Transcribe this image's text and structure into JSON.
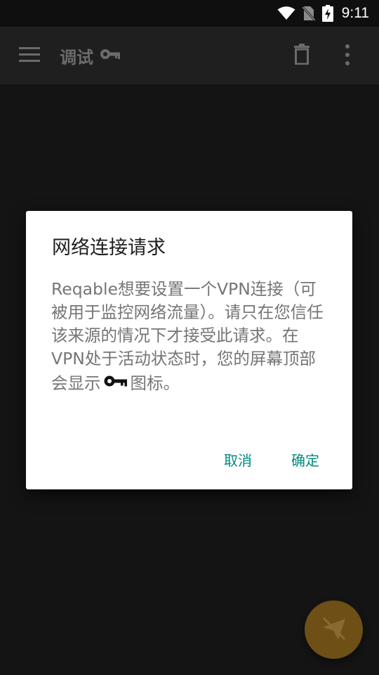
{
  "status_bar": {
    "time": "9:11",
    "icons": [
      "wifi-icon",
      "no-sim-icon",
      "battery-charging-icon"
    ]
  },
  "app_bar": {
    "title": "调试",
    "title_icon": "vpn-key-icon",
    "menu_icon": "menu-icon",
    "actions": [
      "delete-icon",
      "more-vert-icon"
    ]
  },
  "dialog": {
    "title": "网络连接请求",
    "message_before_icon": "Reqable想要设置一个VPN连接（可被用于监控网络流量）。请只在您信任该来源的情况下才接受此请求。在VPN处于活动状态时，您的屏幕顶部会显示",
    "message_icon": "vpn-key-icon",
    "message_after_icon": "图标。",
    "cancel_label": "取消",
    "confirm_label": "确定"
  },
  "fab": {
    "icon": "send-off-icon"
  },
  "colors": {
    "accent": "#00897b",
    "fab": "#6e4f16",
    "app_bar": "#1f1f1f",
    "background": "#161616"
  }
}
